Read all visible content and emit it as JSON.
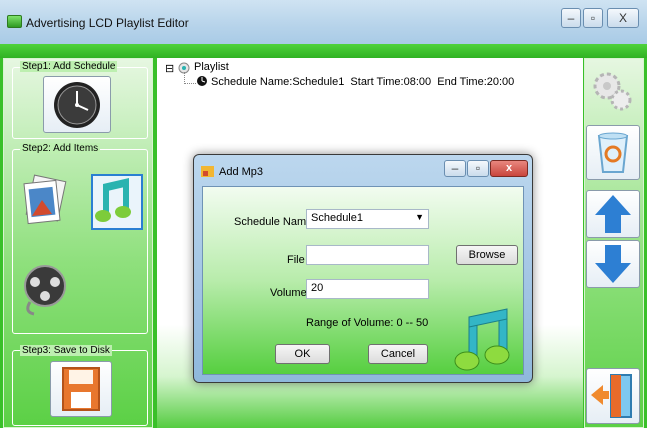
{
  "window": {
    "title": "Advertising LCD Playlist Editor",
    "controls": {
      "minimize": "–",
      "maximize": "▫",
      "close": "X"
    }
  },
  "left_panel": {
    "step1": {
      "label": "Step1: Add Schedule",
      "icon": "clock-icon"
    },
    "step2": {
      "label": "Step2: Add Items",
      "icons": [
        "image-icon",
        "music-icon",
        "film-reel-icon"
      ]
    },
    "step3": {
      "label": "Step3: Save to Disk",
      "icon": "floppy-disk-icon"
    }
  },
  "tree": {
    "root": "Playlist",
    "toggle": "⊟",
    "schedule_item": "Schedule Name:Schedule1  Start Time:08:00  End Time:20:00"
  },
  "right_panel": {
    "icons": [
      "gears-icon",
      "recycle-bin-icon",
      "arrow-up-icon",
      "arrow-down-icon",
      "exit-door-icon"
    ]
  },
  "dialog": {
    "title": "Add Mp3",
    "schedule_label": "Schedule Name",
    "schedule_value": "Schedule1",
    "file_label": "File",
    "file_value": "",
    "browse_label": "Browse",
    "volume_label": "Volume",
    "volume_value": "20",
    "range_text": "Range of Volume: 0 -- 50",
    "ok_label": "OK",
    "cancel_label": "Cancel",
    "colors": {
      "close_button": "#c9463d",
      "accent_blue": "#2a7fd2"
    }
  }
}
